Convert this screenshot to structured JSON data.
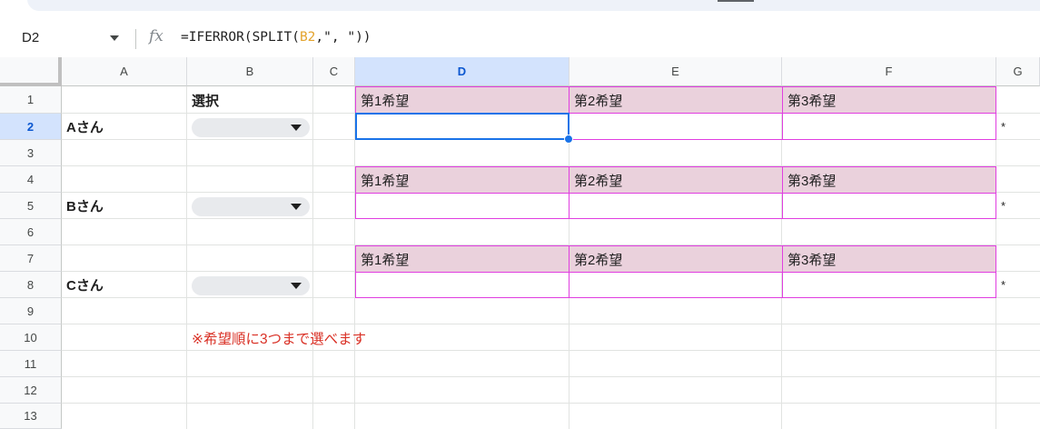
{
  "formula_bar": {
    "name_box": "D2",
    "fx_icon": "function-icon",
    "formula_prefix": "=IFERROR(SPLIT(",
    "formula_ref": "B2",
    "formula_suffix": ",\", \"))"
  },
  "columns": [
    "A",
    "B",
    "C",
    "D",
    "E",
    "F",
    "G"
  ],
  "rows": [
    "1",
    "2",
    "3",
    "4",
    "5",
    "6",
    "7",
    "8",
    "9",
    "10",
    "11",
    "12",
    "13"
  ],
  "selected_cell": "D2",
  "cells": {
    "B1": "選択",
    "A2": "Aさん",
    "A5": "Bさん",
    "A8": "Cさん",
    "D1": "第1希望",
    "E1": "第2希望",
    "F1": "第3希望",
    "D4": "第1希望",
    "E4": "第2希望",
    "F4": "第3希望",
    "D7": "第1希望",
    "E7": "第2希望",
    "F7": "第3希望",
    "G2": "*",
    "G5": "*",
    "G8": "*",
    "B10": "※希望順に3つまで選べます"
  },
  "dropdowns": [
    {
      "cell": "B2",
      "value": ""
    },
    {
      "cell": "B5",
      "value": ""
    },
    {
      "cell": "B8",
      "value": ""
    }
  ],
  "colors": {
    "header_fill": "#ead1dc",
    "border_magenta": "#e03ee0",
    "note_red": "#d93025",
    "selection_blue": "#1a73e8",
    "formula_ref": "#e3a32d"
  }
}
